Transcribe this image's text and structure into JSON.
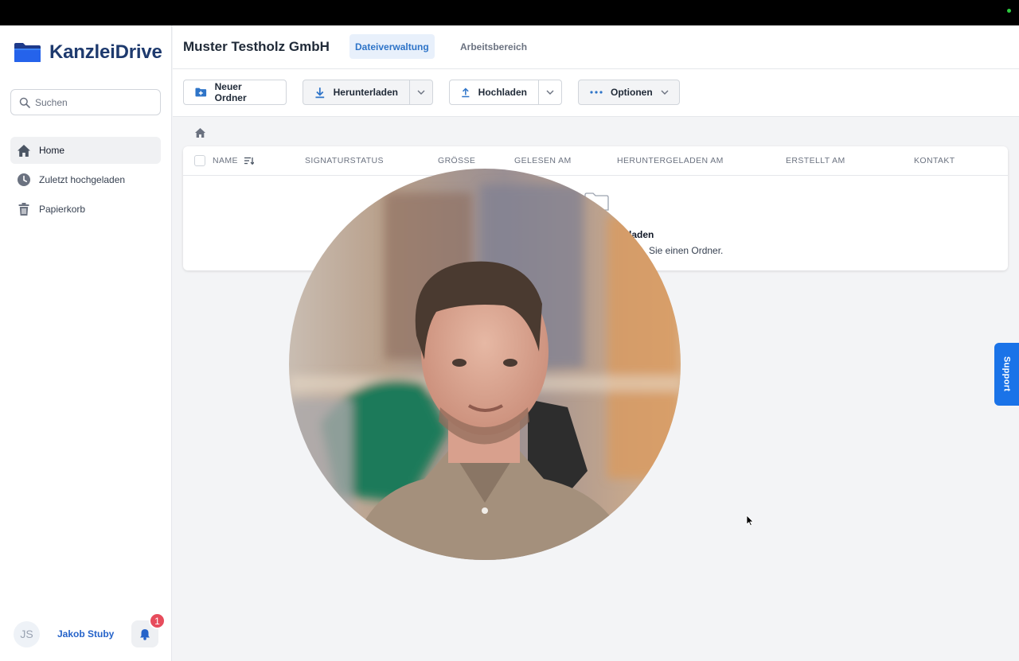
{
  "app": {
    "name": "KanzleiDrive",
    "brand_color": "#1e3a6e",
    "accent_color": "#2e74c8"
  },
  "sidebar": {
    "search_placeholder": "Suchen",
    "items": [
      {
        "label": "Home",
        "icon": "home-icon",
        "active": true
      },
      {
        "label": "Zuletzt hochgeladen",
        "icon": "clock-icon",
        "active": false
      },
      {
        "label": "Papierkorb",
        "icon": "trash-icon",
        "active": false
      }
    ],
    "user": {
      "initials": "JS",
      "name": "Jakob Stuby",
      "notification_count": "1"
    }
  },
  "header": {
    "company": "Muster Testholz GmbH",
    "tabs": [
      {
        "label": "Dateiverwaltung",
        "active": true
      },
      {
        "label": "Arbeitsbereich",
        "active": false
      }
    ]
  },
  "toolbar": {
    "new_folder": "Neuer Ordner",
    "download": "Herunterladen",
    "upload": "Hochladen",
    "options": "Optionen"
  },
  "table": {
    "columns": [
      "NAME",
      "SIGNATURSTATUS",
      "GRÖSSE",
      "GELESEN AM",
      "HERUNTERGELADEN AM",
      "ERSTELLT AM",
      "KONTAKT"
    ],
    "empty_title": "laden",
    "empty_subtitle": "Sie einen Ordner."
  },
  "support_tab": "Support"
}
